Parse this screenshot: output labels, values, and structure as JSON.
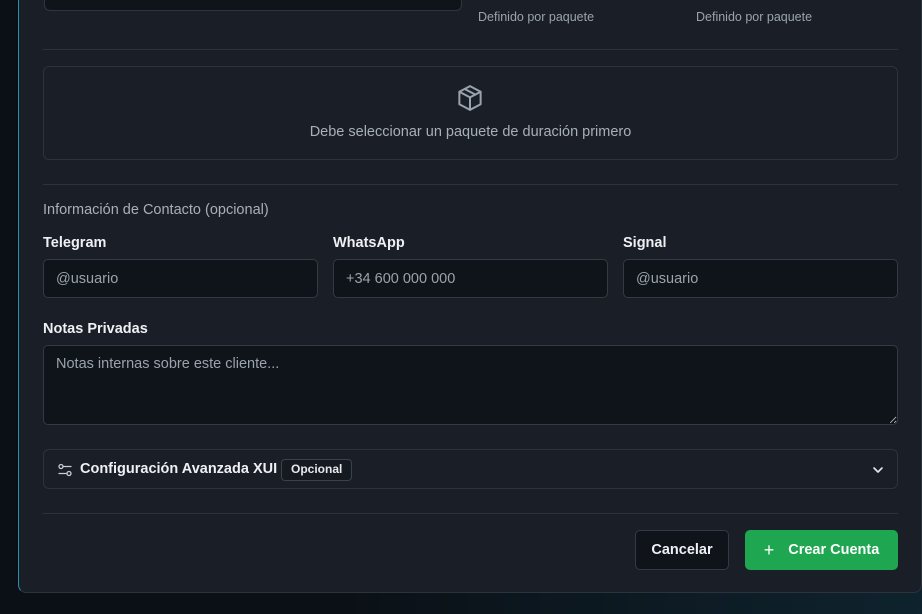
{
  "packages": {
    "left_derived": "Definido por paquete",
    "right_derived": "Definido por paquete",
    "empty_message": "Debe seleccionar un paquete de duración primero",
    "empty_icon": "package-icon"
  },
  "contact": {
    "section_title": "Información de Contacto (opcional)",
    "telegram": {
      "label": "Telegram",
      "placeholder": "@usuario"
    },
    "whatsapp": {
      "label": "WhatsApp",
      "placeholder": "+34 600 000 000"
    },
    "signal": {
      "label": "Signal",
      "placeholder": "@usuario"
    }
  },
  "notes": {
    "label": "Notas Privadas",
    "placeholder": "Notas internas sobre este cliente..."
  },
  "advanced": {
    "title": "Configuración Avanzada XUI",
    "badge": "Opcional",
    "icon": "sliders-icon",
    "expanded": false
  },
  "actions": {
    "cancel_label": "Cancelar",
    "create_label": "Crear Cuenta",
    "create_icon": "plus-icon"
  },
  "colors": {
    "accent_green": "#1ea651",
    "modal_bg": "#1a1f27",
    "input_bg": "#0f131a"
  }
}
